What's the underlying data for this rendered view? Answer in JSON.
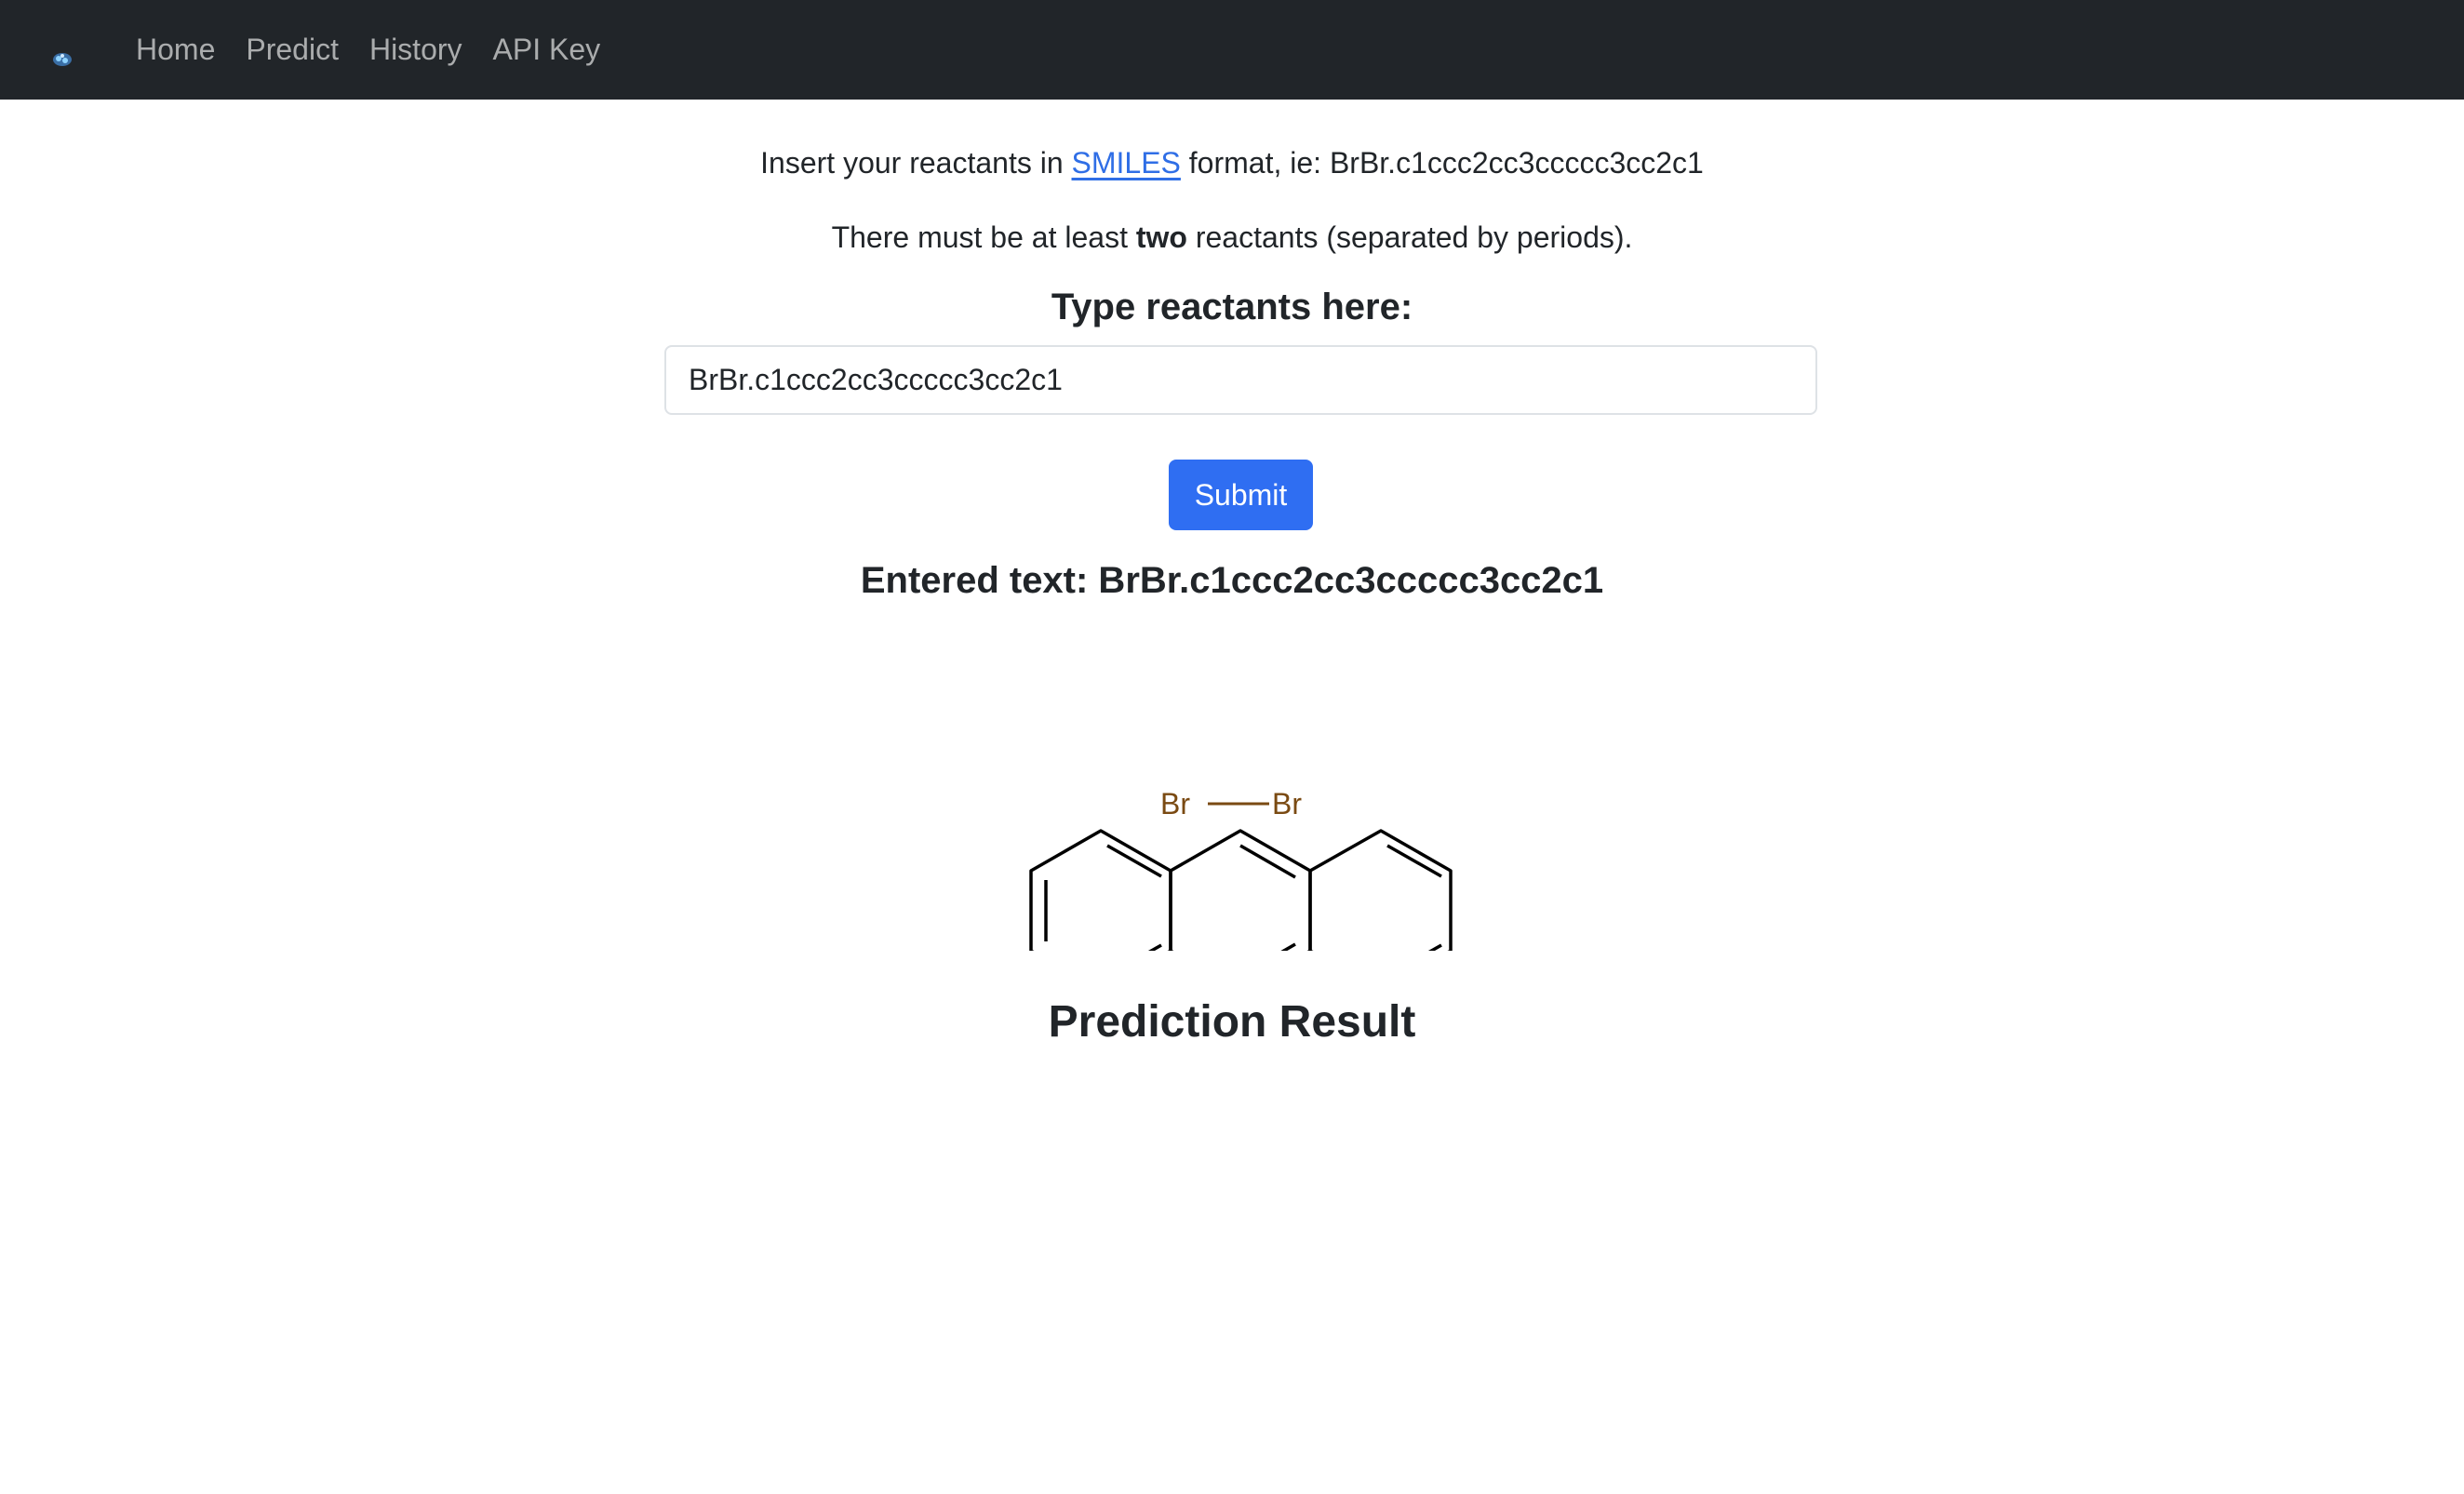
{
  "nav": {
    "brand_icon": "molecule-logo-icon",
    "items": [
      {
        "label": "Home"
      },
      {
        "label": "Predict"
      },
      {
        "label": "History"
      },
      {
        "label": "API Key"
      }
    ]
  },
  "intro": {
    "prefix": "Insert your reactants in ",
    "link_text": "SMILES",
    "suffix": " format, ie: BrBr.c1ccc2cc3ccccc3cc2c1"
  },
  "rule": {
    "prefix": "There must be at least ",
    "bold": "two",
    "suffix": " reactants (separated by periods)."
  },
  "form": {
    "label": "Type reactants here:",
    "input_value": "BrBr.c1ccc2cc3ccccc3cc2c1",
    "submit_label": "Submit"
  },
  "entered": {
    "text": "Entered text: BrBr.c1ccc2cc3ccccc3cc2c1"
  },
  "structure": {
    "atom_left": "Br",
    "atom_right": "Br",
    "bromine_color": "#7a4a12"
  },
  "result": {
    "title": "Prediction Result"
  },
  "colors": {
    "navbar": "#212529",
    "link": "#2f6ee6",
    "primary": "#2f6ef2"
  }
}
